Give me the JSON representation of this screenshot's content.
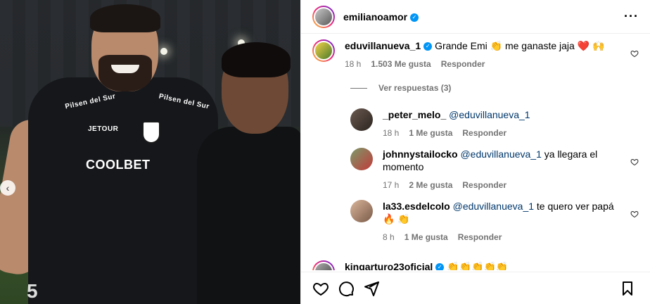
{
  "post": {
    "author": "emilianoamor",
    "verified": true,
    "more_icon": "more-horizontal-icon"
  },
  "photo": {
    "jersey": {
      "sponsor": "COOLBET",
      "maker": "JETOUR",
      "chest_left": "Pilsen del Sur",
      "chest_right": "Pilsen del Sur",
      "number": "5"
    },
    "carousel_prev_icon": "chevron-left-icon"
  },
  "comments": [
    {
      "username": "eduvillanueva_1",
      "verified": true,
      "text": "Grande Emi 👏 me ganaste jaja ❤️ 🙌",
      "time": "18 h",
      "likes": "1.503 Me gusta",
      "reply_label": "Responder"
    }
  ],
  "view_replies": "Ver respuestas (3)",
  "replies": [
    {
      "username": "_peter_melo_",
      "mention": "@eduvillanueva_1",
      "text": "",
      "time": "18 h",
      "likes": "1 Me gusta",
      "reply_label": "Responder"
    },
    {
      "username": "johnnystailocko",
      "mention": "@eduvillanueva_1",
      "text": "ya llegara el momento",
      "time": "17 h",
      "likes": "2 Me gusta",
      "reply_label": "Responder"
    },
    {
      "username": "la33.esdelcolo",
      "mention": "@eduvillanueva_1",
      "text": "te quero ver papá 🔥 👏",
      "time": "8 h",
      "likes": "1 Me gusta",
      "reply_label": "Responder"
    }
  ],
  "next_comment": {
    "username": "kingarturo23oficial",
    "verified": true,
    "text": "👏👏👏👏👏"
  },
  "actions": {
    "like_icon": "heart-icon",
    "comment_icon": "comment-icon",
    "share_icon": "send-icon",
    "save_icon": "bookmark-icon"
  },
  "colors": {
    "link": "#00376b",
    "muted": "#737373",
    "verified": "#0095f6",
    "border": "#efefef"
  }
}
